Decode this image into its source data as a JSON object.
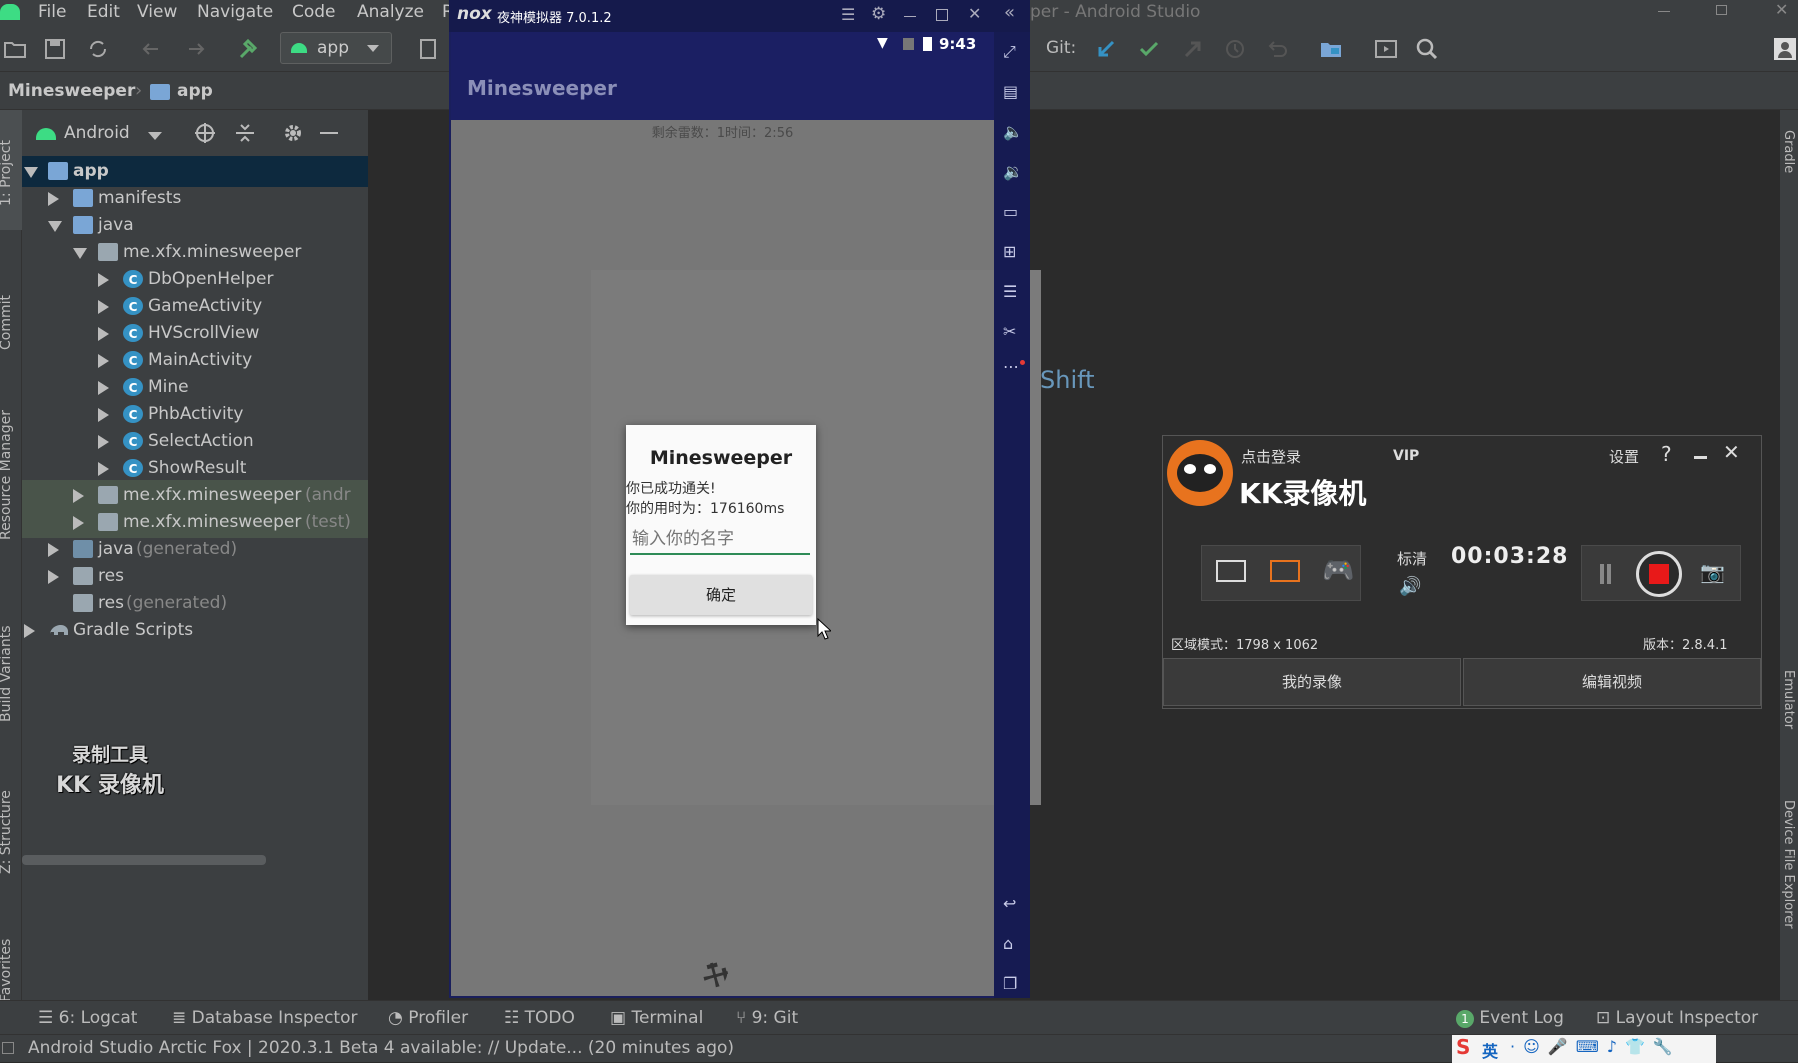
{
  "menubar": {
    "items": [
      "File",
      "Edit",
      "View",
      "Navigate",
      "Code",
      "Analyze",
      "R"
    ],
    "window_title": "per - Android Studio"
  },
  "toolbar": {
    "run_config": "app",
    "git_label": "Git:"
  },
  "breadcrumb": {
    "project": "Minesweeper",
    "module": "app"
  },
  "project_panel": {
    "view_mode": "Android",
    "tree": [
      {
        "label": "app",
        "depth": 0,
        "expanded": true,
        "icon": "module",
        "selected": true
      },
      {
        "label": "manifests",
        "depth": 1,
        "expanded": false,
        "icon": "folder"
      },
      {
        "label": "java",
        "depth": 1,
        "expanded": true,
        "icon": "folder"
      },
      {
        "label": "me.xfx.minesweeper",
        "depth": 2,
        "expanded": true,
        "icon": "package"
      },
      {
        "label": "DbOpenHelper",
        "depth": 3,
        "expanded": false,
        "icon": "class"
      },
      {
        "label": "GameActivity",
        "depth": 3,
        "expanded": false,
        "icon": "class"
      },
      {
        "label": "HVScrollView",
        "depth": 3,
        "expanded": false,
        "icon": "class"
      },
      {
        "label": "MainActivity",
        "depth": 3,
        "expanded": false,
        "icon": "class"
      },
      {
        "label": "Mine",
        "depth": 3,
        "expanded": false,
        "icon": "class"
      },
      {
        "label": "PhbActivity",
        "depth": 3,
        "expanded": false,
        "icon": "class"
      },
      {
        "label": "SelectAction",
        "depth": 3,
        "expanded": false,
        "icon": "class"
      },
      {
        "label": "ShowResult",
        "depth": 3,
        "expanded": false,
        "icon": "class"
      },
      {
        "label": "me.xfx.minesweeper",
        "suffix": "(andr",
        "depth": 2,
        "expanded": false,
        "icon": "package",
        "highlight": true
      },
      {
        "label": "me.xfx.minesweeper",
        "suffix": "(test)",
        "depth": 2,
        "expanded": false,
        "icon": "package",
        "highlight": true
      },
      {
        "label": "java",
        "suffix": "(generated)",
        "depth": 1,
        "expanded": false,
        "icon": "gen-folder"
      },
      {
        "label": "res",
        "depth": 1,
        "expanded": false,
        "icon": "res-folder"
      },
      {
        "label": "res",
        "suffix": "(generated)",
        "depth": 1,
        "expanded": null,
        "icon": "res-folder"
      },
      {
        "label": "Gradle Scripts",
        "depth": 0,
        "expanded": false,
        "icon": "gradle"
      }
    ]
  },
  "left_strip_tabs": [
    "1: Project",
    "Commit",
    "Resource Manager",
    "Build Variants",
    "Z: Structure",
    "Favorites"
  ],
  "right_strip_tabs": [
    "Gradle",
    "Emulator",
    "Device File Explorer"
  ],
  "watermark": {
    "line1": "录制工具",
    "line2": "KK 录像机"
  },
  "editor_hint": "Shift",
  "bottom_tabs": [
    {
      "label": "6: Logcat",
      "icon": "logcat-icon"
    },
    {
      "label": "Database Inspector",
      "icon": "database-icon"
    },
    {
      "label": "Profiler",
      "icon": "profiler-icon"
    },
    {
      "label": "TODO",
      "icon": "todo-icon"
    },
    {
      "label": "Terminal",
      "icon": "terminal-icon"
    },
    {
      "label": "9: Git",
      "icon": "git-icon"
    }
  ],
  "bottom_right_tabs": [
    {
      "label": "Event Log",
      "badge": "1"
    },
    {
      "label": "Layout Inspector"
    }
  ],
  "status_text": "Android Studio Arctic Fox | 2020.3.1 Beta 4 available: // Update... (20 minutes ago)",
  "ime": {
    "mode": "英"
  },
  "emulator": {
    "title": "夜神模拟器 7.0.1.2",
    "brand": "nox",
    "clock": "9:43",
    "app_title": "Minesweeper",
    "game_info": "剩余雷数：1时间：2:56",
    "dialog": {
      "title": "Minesweeper",
      "message1": "你已成功通关!",
      "message2": "你的用时为：176160ms",
      "input_placeholder": "输入你的名字",
      "confirm": "确定"
    }
  },
  "kk": {
    "login": "点击登录",
    "vip": "VIP",
    "settings": "设置",
    "help": "?",
    "app_name": "KK录像机",
    "quality": "标清",
    "timer": "00:03:28",
    "region": "区域模式：1798 x 1062",
    "version": "版本：2.8.4.1",
    "my_videos": "我的录像",
    "edit_video": "编辑视频",
    "colors": {
      "record": "#e81919",
      "accent": "#e8731e"
    }
  }
}
